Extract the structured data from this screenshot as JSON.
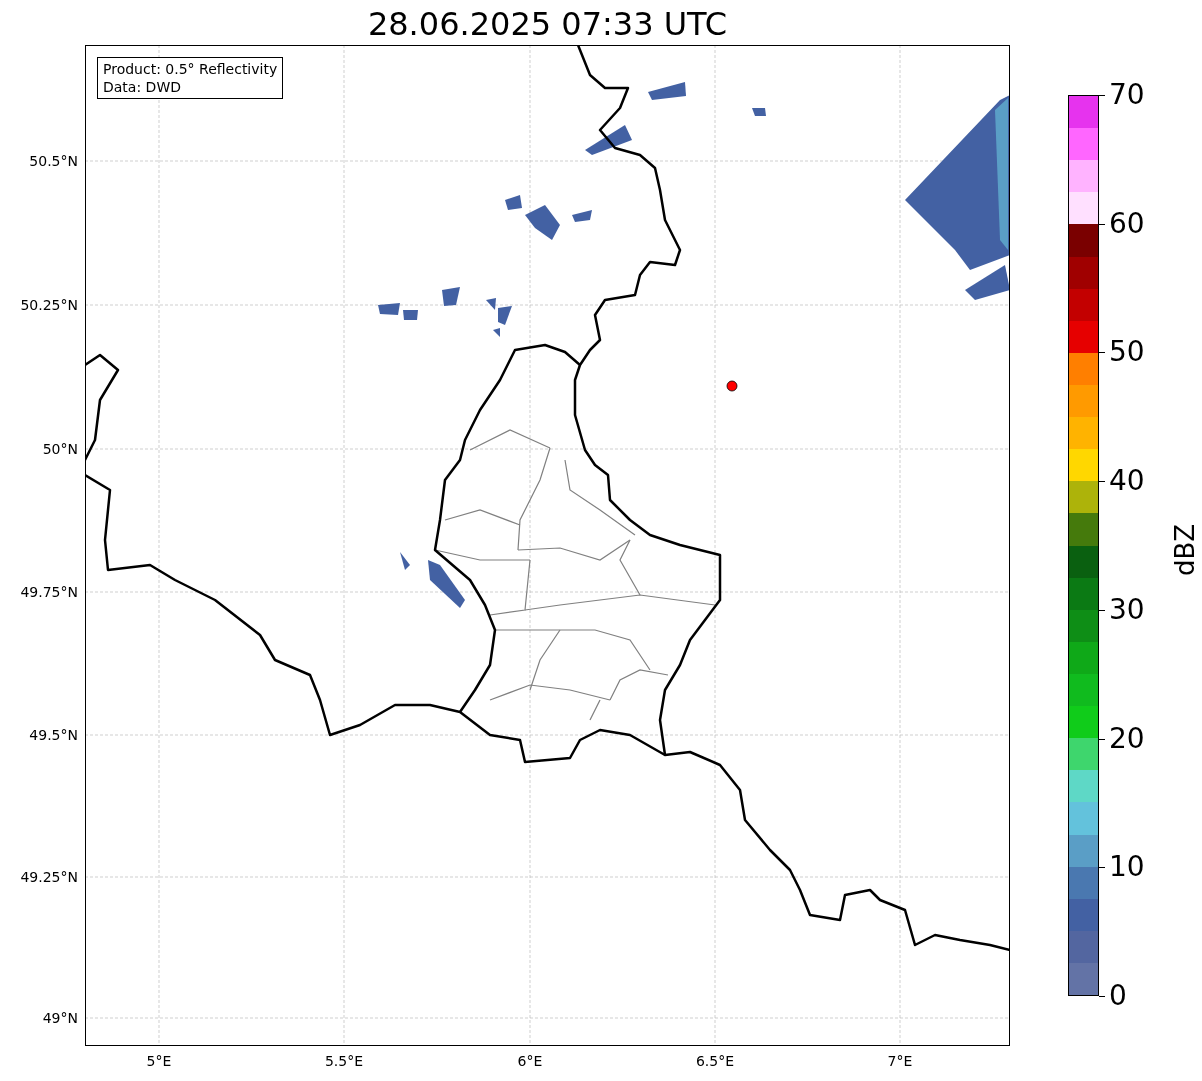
{
  "title": "28.06.2025 07:33 UTC",
  "legend": [
    "Product: 0.5° Reflectivity",
    "Data: DWD"
  ],
  "map": {
    "lon_labels": [
      "5°E",
      "5.5°E",
      "6°E",
      "6.5°E",
      "7°E"
    ],
    "lat_labels": [
      "50.5°N",
      "50.25°N",
      "50°N",
      "49.75°N",
      "49.5°N",
      "49.25°N",
      "49°N"
    ]
  },
  "colorbar": {
    "label": "dBZ",
    "ticks": [
      "70",
      "60",
      "50",
      "40",
      "30",
      "20",
      "10",
      "0"
    ],
    "bands": [
      {
        "color": "#e633ee"
      },
      {
        "color": "#ff66ff"
      },
      {
        "color": "#ffb3ff"
      },
      {
        "color": "#ffe0ff"
      },
      {
        "color": "#7a0000"
      },
      {
        "color": "#a00000"
      },
      {
        "color": "#c30000"
      },
      {
        "color": "#e60000"
      },
      {
        "color": "#ff7f00"
      },
      {
        "color": "#ff9a00"
      },
      {
        "color": "#ffb300"
      },
      {
        "color": "#ffd700"
      },
      {
        "color": "#adb30a"
      },
      {
        "color": "#457a0c"
      },
      {
        "color": "#0a6010"
      },
      {
        "color": "#0b7a14"
      },
      {
        "color": "#0e8e16"
      },
      {
        "color": "#0fa918"
      },
      {
        "color": "#10bb1e"
      },
      {
        "color": "#10cc1a"
      },
      {
        "color": "#3ed66d"
      },
      {
        "color": "#5ed8c6"
      },
      {
        "color": "#63c2dc"
      },
      {
        "color": "#5a9ec6"
      },
      {
        "color": "#4a78b0"
      },
      {
        "color": "#4361a3"
      },
      {
        "color": "#5366a0"
      },
      {
        "color": "#6373a6"
      }
    ]
  }
}
